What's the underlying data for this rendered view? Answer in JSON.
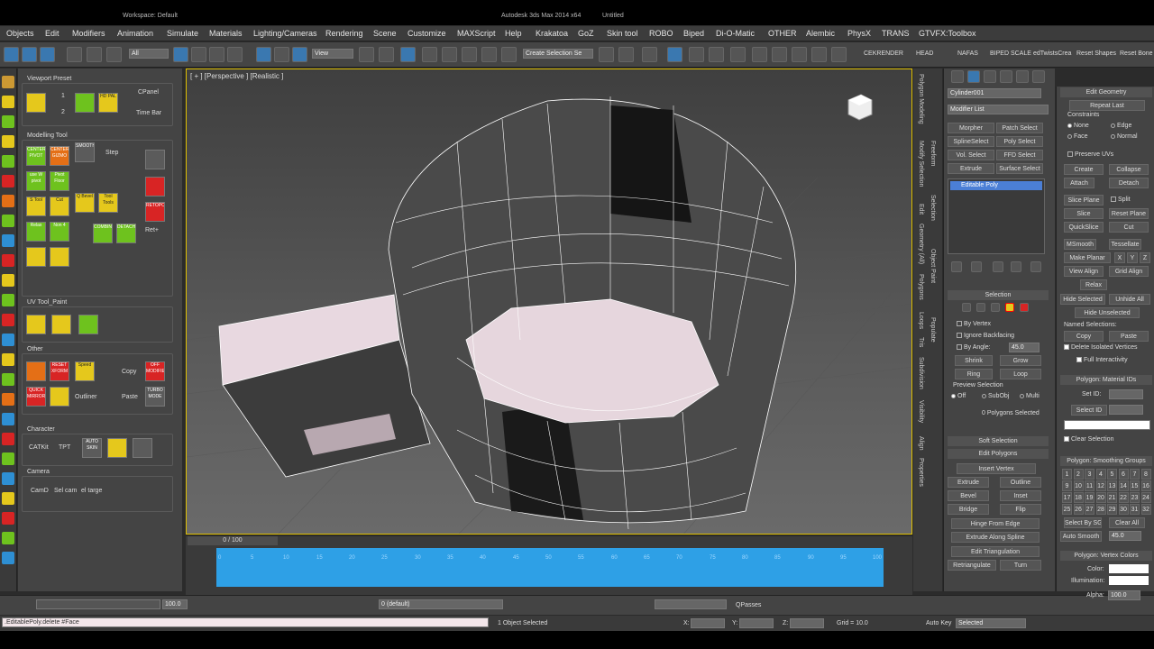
{
  "titlebar": {
    "workspace": "Workspace: Default",
    "app": "Autodesk 3ds Max 2014 x64",
    "doc": "Untitled"
  },
  "menu": [
    "Objects",
    "Edit",
    "Modifiers",
    "Animation",
    "Simulate",
    "Materials",
    "Lighting/Cameras",
    "Rendering",
    "Scene",
    "Customize",
    "MAXScript",
    "Help",
    "Krakatoa",
    "GoZ",
    "Skin tool",
    "ROBO",
    "Biped",
    "Di-O-Matic",
    "OTHER",
    "Alembic",
    "PhysX",
    "TRANS",
    "GTVFX:Toolbox"
  ],
  "toolbar": {
    "filter": "All",
    "view": "View",
    "sel_set": "Create Selection Se",
    "cekrender": "CEKRENDER",
    "head": "HEAD",
    "nafas": "NAFAS",
    "biped_scale": "BIPED SCALE",
    "edtwist": "edTwistsCrea",
    "reset_shapes": "Reset Shapes",
    "reset_bones": "Reset Bone"
  },
  "left": {
    "viewport_preset": "Viewport Preset",
    "n1": "1",
    "n2": "2",
    "cpanel": "CPanel",
    "timebar": "Time Bar",
    "hdpal": "HD PAL",
    "modelling_tool": "Modelling Tool",
    "center_pivot": "CENTER PIVOT",
    "center_gizmo": "CENTER GIZMO",
    "smooth": "SMOOTH",
    "step": "Step",
    "use_w_pivot": "use W pivot",
    "pivot_floor": "Pivot Floor",
    "stool": "S Tool",
    "cut": "Cut",
    "qbevel": "Q Bevel",
    "tooltools": "Tool Tools",
    "retopo": "RETOPO",
    "relax": "Relax",
    "non4": "Non 4",
    "combine": "COMBINE",
    "detach": "DETACH",
    "ret": "Ret+",
    "uv_tool": "UV Tool_Paint",
    "other": "Other",
    "reset_xform": "RESET XFORM",
    "speed": "Speed",
    "copy": "Copy",
    "off_modifier": "OFF MODIFIER",
    "quick_mirror": "QUICK MIRROR",
    "outliner": "Outliner",
    "paste": "Paste",
    "turbo_mode": "TURBO MODE",
    "character": "Character",
    "catkit": "CATKit",
    "tpt": "TPT",
    "auto_skin": "AUTO SKIN",
    "camera": "Camera",
    "camd": "CamD",
    "sel_cam": "Sel cam",
    "el_targe": "el targe"
  },
  "viewport": {
    "label": "[ + ] [Perspective ] [Realistic ]"
  },
  "timeline": {
    "frame": "0 / 100",
    "ticks": [
      "0",
      "5",
      "10",
      "15",
      "20",
      "25",
      "30",
      "35",
      "40",
      "45",
      "50",
      "55",
      "60",
      "65",
      "70",
      "75",
      "80",
      "85",
      "90",
      "95",
      "100"
    ]
  },
  "status": {
    "fps": "100.0",
    "layer": "0 (default)",
    "qpasses": "QPasses",
    "selected": "1 Object Selected",
    "x": "X:",
    "y": "Y:",
    "z": "Z:",
    "grid": "Grid = 10.0",
    "autokey": "Auto Key",
    "keymode": "Selected",
    "script": ".EditablePoly.delete #Face"
  },
  "vtabs": [
    "Polygon Modeling",
    "Modify Selection",
    "Edit",
    "Geometry (All)",
    "Polygons",
    "Loops",
    "Tris",
    "Subdivision",
    "Visibility",
    "Align",
    "Properties",
    "Freeform",
    "Selection",
    "Object Paint",
    "Populate"
  ],
  "cmd": {
    "objname": "Cylinder001",
    "modlist": "Modifier List",
    "mods": [
      "Morpher",
      "Patch Select",
      "SplineSelect",
      "Poly Select",
      "Vol. Select",
      "FFD Select",
      "Extrude",
      "Surface Select"
    ],
    "stack": "Editable Poly",
    "selection": "Selection",
    "by_vertex": "By Vertex",
    "ignore_backfacing": "Ignore Backfacing",
    "by_angle": "By Angle:",
    "angle": "45.0",
    "shrink": "Shrink",
    "grow": "Grow",
    "ring": "Ring",
    "loop": "Loop",
    "preview": "Preview Selection",
    "off": "Off",
    "subobj": "SubObj",
    "multi": "Multi",
    "poly_sel": "0 Polygons Selected",
    "soft": "Soft Selection",
    "edit_polys": "Edit Polygons",
    "insert_vertex": "Insert Vertex",
    "extrude": "Extrude",
    "outline": "Outline",
    "bevel": "Bevel",
    "inset": "Inset",
    "bridge": "Bridge",
    "flip": "Flip",
    "hinge": "Hinge From Edge",
    "extrude_spline": "Extrude Along Spline",
    "edit_tri": "Edit Triangulation",
    "retri": "Retriangulate",
    "turn": "Turn"
  },
  "cmd2": {
    "edit_geom": "Edit Geometry",
    "repeat": "Repeat Last",
    "constraints": "Constraints",
    "none": "None",
    "edge": "Edge",
    "face": "Face",
    "normal": "Normal",
    "preserve_uvs": "Preserve UVs",
    "create": "Create",
    "collapse": "Collapse",
    "attach": "Attach",
    "detach": "Detach",
    "slice_plane": "Slice Plane",
    "split": "Split",
    "slice": "Slice",
    "reset_plane": "Reset Plane",
    "quickslice": "QuickSlice",
    "cut": "Cut",
    "msmooth": "MSmooth",
    "tessellate": "Tessellate",
    "make_planar": "Make Planar",
    "xx": "X",
    "yy": "Y",
    "zz": "Z",
    "view_align": "View Align",
    "grid_align": "Grid Align",
    "relax": "Relax",
    "hide_sel": "Hide Selected",
    "unhide_all": "Unhide All",
    "hide_unsel": "Hide Unselected",
    "named_sel": "Named Selections:",
    "copy": "Copy",
    "paste": "Paste",
    "del_iso": "Delete Isolated Vertices",
    "full_inter": "Full Interactivity",
    "mat_ids": "Polygon: Material IDs",
    "set_id": "Set ID:",
    "select_id": "Select ID",
    "clear_sel": "Clear Selection",
    "smooth_groups": "Polygon: Smoothing Groups",
    "sg": [
      "1",
      "2",
      "3",
      "4",
      "5",
      "6",
      "7",
      "8",
      "9",
      "10",
      "11",
      "12",
      "13",
      "14",
      "15",
      "16",
      "17",
      "18",
      "19",
      "20",
      "21",
      "22",
      "23",
      "24",
      "25",
      "26",
      "27",
      "28",
      "29",
      "30",
      "31",
      "32"
    ],
    "select_by_sg": "Select By SG",
    "clear_all": "Clear All",
    "auto_smooth": "Auto Smooth",
    "auto_val": "45.0",
    "vertex_colors": "Polygon: Vertex Colors",
    "color": "Color:",
    "illum": "Illumination:",
    "alpha": "Alpha:",
    "alpha_val": "100.0"
  }
}
